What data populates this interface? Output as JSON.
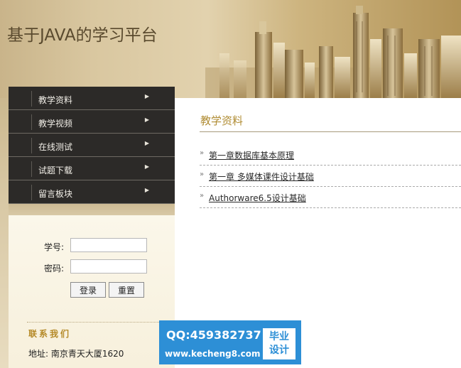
{
  "banner": {
    "title": "基于JAVA的学习平台"
  },
  "nav": {
    "items": [
      {
        "label": "教学资料",
        "icon": "arrow-right-icon"
      },
      {
        "label": "教学视频",
        "icon": "arrow-right-icon"
      },
      {
        "label": "在线测试",
        "icon": "arrow-right-icon"
      },
      {
        "label": "试题下载",
        "icon": "arrow-right-icon"
      },
      {
        "label": "留言板块",
        "icon": "arrow-right-icon"
      }
    ]
  },
  "login": {
    "student_id_label": "学号:",
    "student_id_value": "",
    "password_label": "密码:",
    "password_value": "",
    "login_button": "登录",
    "reset_button": "重置"
  },
  "contact": {
    "title": "联系我们",
    "address": "地址: 南京青天大厦1620"
  },
  "main": {
    "section_title": "教学资料",
    "documents": [
      {
        "title": "第一章数据库基本原理"
      },
      {
        "title": "第一章 多媒体课件设计基础"
      },
      {
        "title": "Authorware6.5设计基础"
      }
    ]
  },
  "watermark": {
    "qq": "QQ:459382737",
    "url": "www.kecheng8.com",
    "badge_line1": "毕业",
    "badge_line2": "设计"
  },
  "colors": {
    "nav_bg": "#2c2a28",
    "title_gold": "#b08c33",
    "watermark_blue": "#2d8fd6"
  }
}
